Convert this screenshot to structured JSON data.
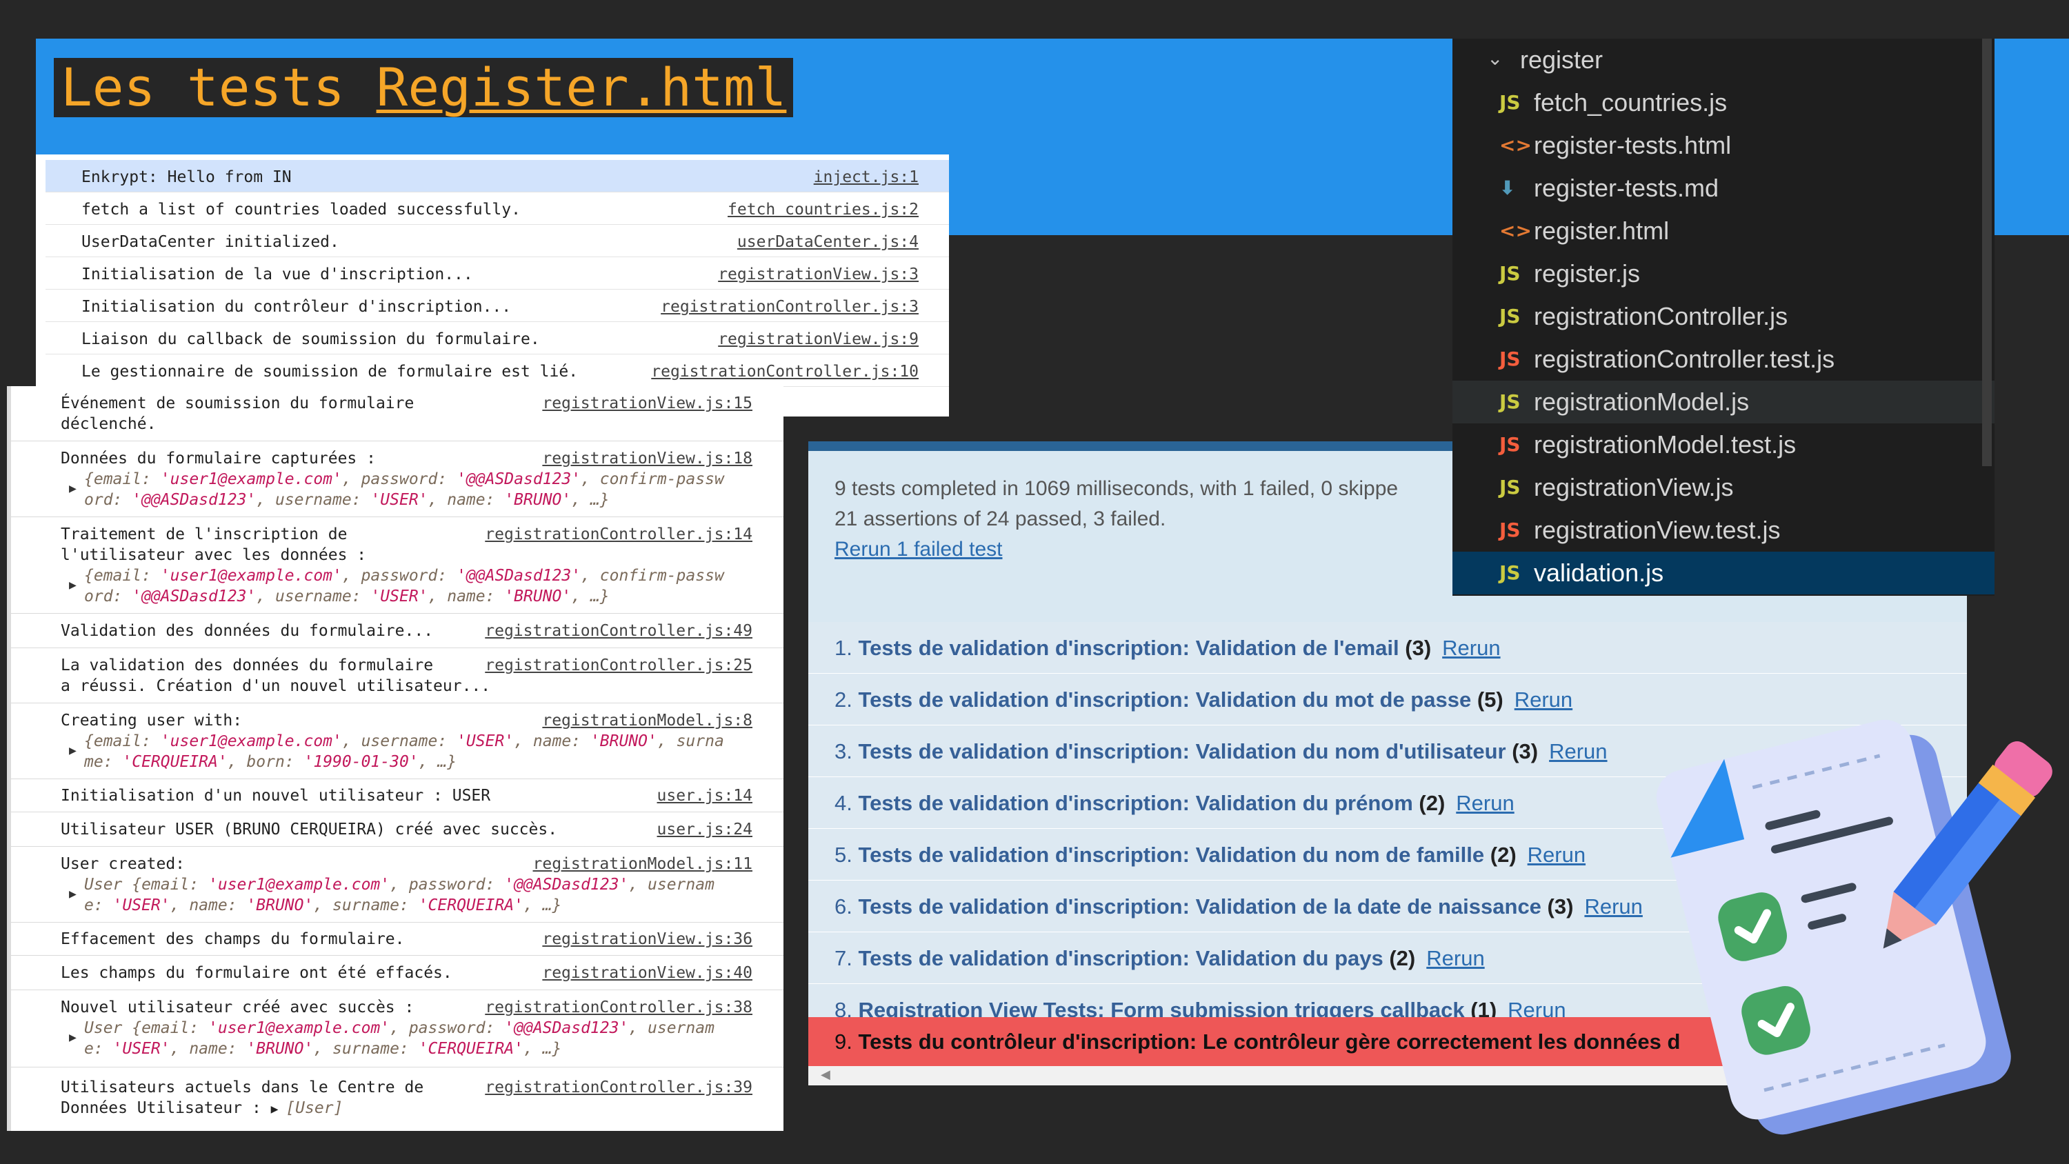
{
  "slide": {
    "title_prefix": "Les tests ",
    "title_link": "Register.html"
  },
  "console_top": [
    {
      "msg": "Enkrypt: Hello from IN",
      "src": "inject.js:1"
    },
    {
      "msg": "fetch a list of countries loaded successfully.",
      "src": "fetch countries.js:2"
    },
    {
      "msg": "UserDataCenter initialized.",
      "src": "userDataCenter.js:4"
    },
    {
      "msg": "Initialisation de la vue d'inscription...",
      "src": "registrationView.js:3"
    },
    {
      "msg": "Initialisation du contrôleur d'inscription...",
      "src": "registrationController.js:3"
    },
    {
      "msg": "Liaison du callback de soumission du formulaire.",
      "src": "registrationView.js:9"
    },
    {
      "msg": "Le gestionnaire de soumission de formulaire est lié.",
      "src": "registrationController.js:10"
    }
  ],
  "console_main": {
    "e1": {
      "l1": "Événement de soumission du formulaire",
      "l2": "déclenché.",
      "src": "registrationView.js:15"
    },
    "e2": {
      "l1": "Données du formulaire capturées :",
      "src": "registrationView.js:18",
      "o1a": "{email: ",
      "o1b": "'user1@example.com'",
      "o1c": ", password: ",
      "o1d": "'@@ASDasd123'",
      "o1e": ", confirm-passw",
      "o2a": "ord: ",
      "o2b": "'@@ASDasd123'",
      "o2c": ", username: ",
      "o2d": "'USER'",
      "o2e": ", name: ",
      "o2f": "'BRUNO'",
      "o2g": ", …}"
    },
    "e3": {
      "l1": "Traitement de l'inscription de",
      "l2": "l'utilisateur avec les données :",
      "src": "registrationController.js:14",
      "o1a": "{email: ",
      "o1b": "'user1@example.com'",
      "o1c": ", password: ",
      "o1d": "'@@ASDasd123'",
      "o1e": ", confirm-passw",
      "o2a": "ord: ",
      "o2b": "'@@ASDasd123'",
      "o2c": ", username: ",
      "o2d": "'USER'",
      "o2e": ", name: ",
      "o2f": "'BRUNO'",
      "o2g": ", …}"
    },
    "e4": {
      "l1": "Validation des données du formulaire...",
      "src": "registrationController.js:49"
    },
    "e5": {
      "l1": "La validation des données du formulaire",
      "l2": "a réussi. Création d'un nouvel utilisateur...",
      "src": "registrationController.js:25"
    },
    "e6": {
      "l1": "Creating user with:",
      "src": "registrationModel.js:8",
      "o1a": "{email: ",
      "o1b": "'user1@example.com'",
      "o1c": ", username: ",
      "o1d": "'USER'",
      "o1e": ", name: ",
      "o1f": "'BRUNO'",
      "o1g": ", surna",
      "o2a": "me: ",
      "o2b": "'CERQUEIRA'",
      "o2c": ", born: ",
      "o2d": "'1990-01-30'",
      "o2e": ", …}"
    },
    "e7": {
      "l1": "Initialisation d'un nouvel utilisateur : USER",
      "src": "user.js:14"
    },
    "e8": {
      "l1": "Utilisateur USER (BRUNO CERQUEIRA) créé avec succès.",
      "src": "user.js:24"
    },
    "e9": {
      "l1": "User created:",
      "src": "registrationModel.js:11",
      "o1a": "User {email: ",
      "o1b": "'user1@example.com'",
      "o1c": ", password: ",
      "o1d": "'@@ASDasd123'",
      "o1e": ", usernam",
      "o2a": "e: ",
      "o2b": "'USER'",
      "o2c": ", name: ",
      "o2d": "'BRUNO'",
      "o2e": ", surname: ",
      "o2f": "'CERQUEIRA'",
      "o2g": ", …}"
    },
    "e10": {
      "l1": "Effacement des champs du formulaire.",
      "src": "registrationView.js:36"
    },
    "e11": {
      "l1": "Les champs du formulaire ont été effacés.",
      "src": "registrationView.js:40"
    },
    "e12": {
      "l1": "Nouvel utilisateur créé avec succès :",
      "src": "registrationController.js:38",
      "o1a": "User {email: ",
      "o1b": "'user1@example.com'",
      "o1c": ", password: ",
      "o1d": "'@@ASDasd123'",
      "o1e": ", usernam",
      "o2a": "e: ",
      "o2b": "'USER'",
      "o2c": ", name: ",
      "o2d": "'BRUNO'",
      "o2e": ", surname: ",
      "o2f": "'CERQUEIRA'",
      "o2g": ", …}"
    },
    "e13": {
      "l1": "Utilisateurs actuels dans le Centre de",
      "l2": "Données Utilisateur : ",
      "l2obj": "[User]",
      "src": "registrationController.js:39"
    }
  },
  "qunit": {
    "summary_line1": "9 tests completed in 1069 milliseconds, with 1 failed, 0 skippe",
    "summary_line2": "21 assertions of 24 passed, 3 failed.",
    "rerun_failed": "Rerun 1 failed test",
    "rerun_label": "Rerun",
    "tests": [
      {
        "num": "1. ",
        "module": "Tests de validation d'inscription:",
        "name": " Validation de l'email ",
        "count": "(3)"
      },
      {
        "num": "2. ",
        "module": "Tests de validation d'inscription:",
        "name": " Validation du mot de passe ",
        "count": "(5)"
      },
      {
        "num": "3. ",
        "module": "Tests de validation d'inscription:",
        "name": " Validation du nom d'utilisateur ",
        "count": "(3)"
      },
      {
        "num": "4. ",
        "module": "Tests de validation d'inscription:",
        "name": " Validation du prénom ",
        "count": "(2)"
      },
      {
        "num": "5. ",
        "module": "Tests de validation d'inscription:",
        "name": " Validation du nom de famille ",
        "count": "(2)"
      },
      {
        "num": "6. ",
        "module": "Tests de validation d'inscription:",
        "name": " Validation de la date de naissance ",
        "count": "(3)"
      },
      {
        "num": "7. ",
        "module": "Tests de validation d'inscription:",
        "name": " Validation du pays ",
        "count": "(2)"
      },
      {
        "num": "8. ",
        "module": "Registration View Tests:",
        "name": " Form submission triggers callback ",
        "count": "(1)"
      },
      {
        "num": "9. ",
        "module": "Tests du contrôleur d'inscription:",
        "name": " Le contrôleur gère correctement les données d",
        "count": ""
      }
    ]
  },
  "explorer": {
    "folder": "register",
    "files": [
      {
        "name": "fetch_countries.js",
        "icon": "JS"
      },
      {
        "name": "register-tests.html",
        "icon": "<>"
      },
      {
        "name": "register-tests.md",
        "icon": "⬇"
      },
      {
        "name": "register.html",
        "icon": "<>"
      },
      {
        "name": "register.js",
        "icon": "JS"
      },
      {
        "name": "registrationController.js",
        "icon": "JS"
      },
      {
        "name": "registrationController.test.js",
        "icon": "JS"
      },
      {
        "name": "registrationModel.js",
        "icon": "JS"
      },
      {
        "name": "registrationModel.test.js",
        "icon": "JS"
      },
      {
        "name": "registrationView.js",
        "icon": "JS"
      },
      {
        "name": "registrationView.test.js",
        "icon": "JS"
      },
      {
        "name": "validation.js",
        "icon": "JS"
      }
    ]
  },
  "colors": {
    "accent_blue": "#2591ea",
    "title_orange": "#f6a628",
    "fail_red": "#ee5757",
    "selected_row": "#04395e"
  }
}
